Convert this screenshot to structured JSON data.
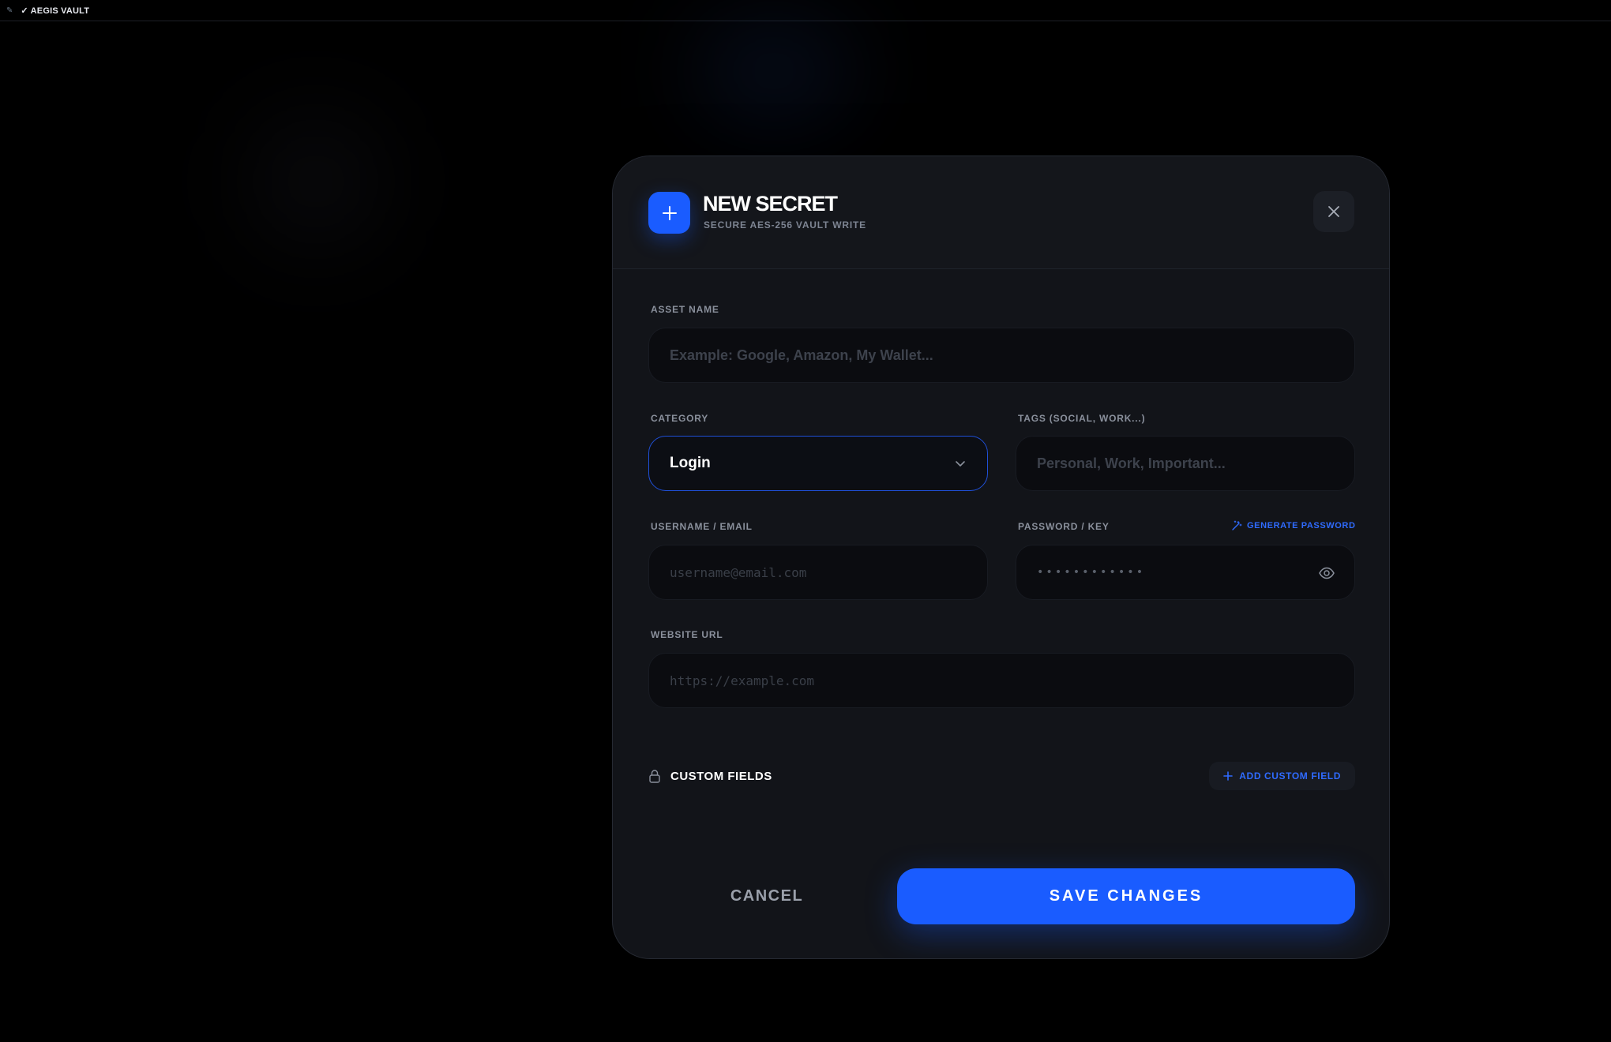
{
  "topbar": {
    "app_icon": "✎",
    "app_title": "✓ AEGIS VAULT"
  },
  "modal": {
    "title": "NEW SECRET",
    "subtitle": "SECURE AES-256 VAULT WRITE",
    "icons": {
      "header": "plus-icon",
      "close": "close-icon"
    }
  },
  "form": {
    "asset_name": {
      "label": "ASSET NAME",
      "placeholder": "Example: Google, Amazon, My Wallet..."
    },
    "category": {
      "label": "CATEGORY",
      "value": "Login",
      "icon": "chevron-down-icon"
    },
    "tags": {
      "label": "TAGS (SOCIAL, WORK...)",
      "placeholder": "Personal, Work, Important..."
    },
    "username": {
      "label": "USERNAME / EMAIL",
      "placeholder": "username@email.com"
    },
    "password": {
      "label": "PASSWORD / KEY",
      "placeholder": "••••••••••••",
      "generate_label": "GENERATE PASSWORD",
      "icons": {
        "generate": "magic-wand-icon",
        "reveal": "eye-icon"
      }
    },
    "website": {
      "label": "WEBSITE URL",
      "placeholder": "https://example.com"
    }
  },
  "custom_fields": {
    "title": "CUSTOM FIELDS",
    "add_label": "ADD CUSTOM FIELD",
    "icon": "lock-icon"
  },
  "actions": {
    "cancel_label": "CANCEL",
    "save_label": "SAVE CHANGES"
  },
  "colors": {
    "accent": "#1a5cff",
    "link": "#2f6bff",
    "modal_bg": "#121419",
    "page_bg": "#000000"
  }
}
